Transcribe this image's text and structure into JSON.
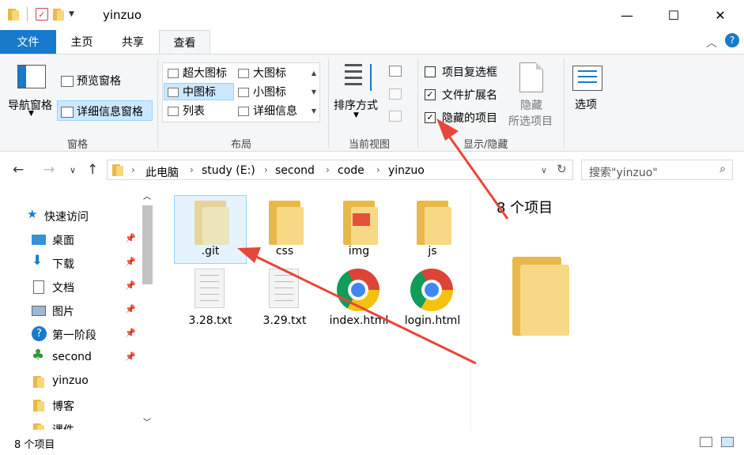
{
  "window": {
    "title": "yinzuo",
    "minimize": "—",
    "maximize": "☐",
    "close": "✕"
  },
  "ribbon": {
    "tabs": [
      "文件",
      "主页",
      "共享",
      "查看"
    ],
    "pane_group": {
      "nav_pane": "导航窗格",
      "preview_pane": "预览窗格",
      "details_pane": "详细信息窗格",
      "label": "窗格"
    },
    "layout_group": {
      "items": [
        "超大图标",
        "大图标",
        "中图标",
        "小图标",
        "列表",
        "详细信息"
      ],
      "selected": "中图标",
      "label": "布局"
    },
    "current_view_group": {
      "sort_by": "排序方式",
      "label": "当前视图"
    },
    "show_hide_group": {
      "item_checkboxes": "项目复选框",
      "file_extensions": "文件扩展名",
      "hidden_items": "隐藏的项目",
      "item_checkboxes_checked": false,
      "file_extensions_checked": true,
      "hidden_items_checked": true,
      "hide_selected_line1": "隐藏",
      "hide_selected_line2": "所选项目",
      "label": "显示/隐藏"
    },
    "options": "选项"
  },
  "address": {
    "breadcrumbs": [
      "此电脑",
      "study (E:)",
      "second",
      "code",
      "yinzuo"
    ],
    "search_placeholder": "搜索\"yinzuo\""
  },
  "sidebar": {
    "items": [
      {
        "label": "快速访问",
        "icon": "star-icon",
        "pinned": false
      },
      {
        "label": "桌面",
        "icon": "desktop-icon",
        "pinned": true
      },
      {
        "label": "下载",
        "icon": "download-icon",
        "pinned": true
      },
      {
        "label": "文档",
        "icon": "document-icon",
        "pinned": true
      },
      {
        "label": "图片",
        "icon": "picture-icon",
        "pinned": true
      },
      {
        "label": "第一阶段",
        "icon": "help-icon",
        "pinned": true
      },
      {
        "label": "second",
        "icon": "tree-icon",
        "pinned": true
      },
      {
        "label": "yinzuo",
        "icon": "folder-icon",
        "pinned": false
      },
      {
        "label": "博客",
        "icon": "folder-icon",
        "pinned": false
      },
      {
        "label": "课件",
        "icon": "folder-icon",
        "pinned": false
      }
    ]
  },
  "files": [
    {
      "name": ".git",
      "type": "folder",
      "hidden": true,
      "selected": true
    },
    {
      "name": "css",
      "type": "folder"
    },
    {
      "name": "img",
      "type": "folder"
    },
    {
      "name": "js",
      "type": "folder"
    },
    {
      "name": "3.28.txt",
      "type": "txt"
    },
    {
      "name": "3.29.txt",
      "type": "txt"
    },
    {
      "name": "index.html",
      "type": "chrome-html"
    },
    {
      "name": "login.html",
      "type": "chrome-html"
    }
  ],
  "preview": {
    "count_text": "8 个项目"
  },
  "status": {
    "count_text": "8 个项目"
  },
  "colors": {
    "accent": "#1979ca",
    "selection": "#cce8ff",
    "annotation_arrow": "#e8453c"
  }
}
